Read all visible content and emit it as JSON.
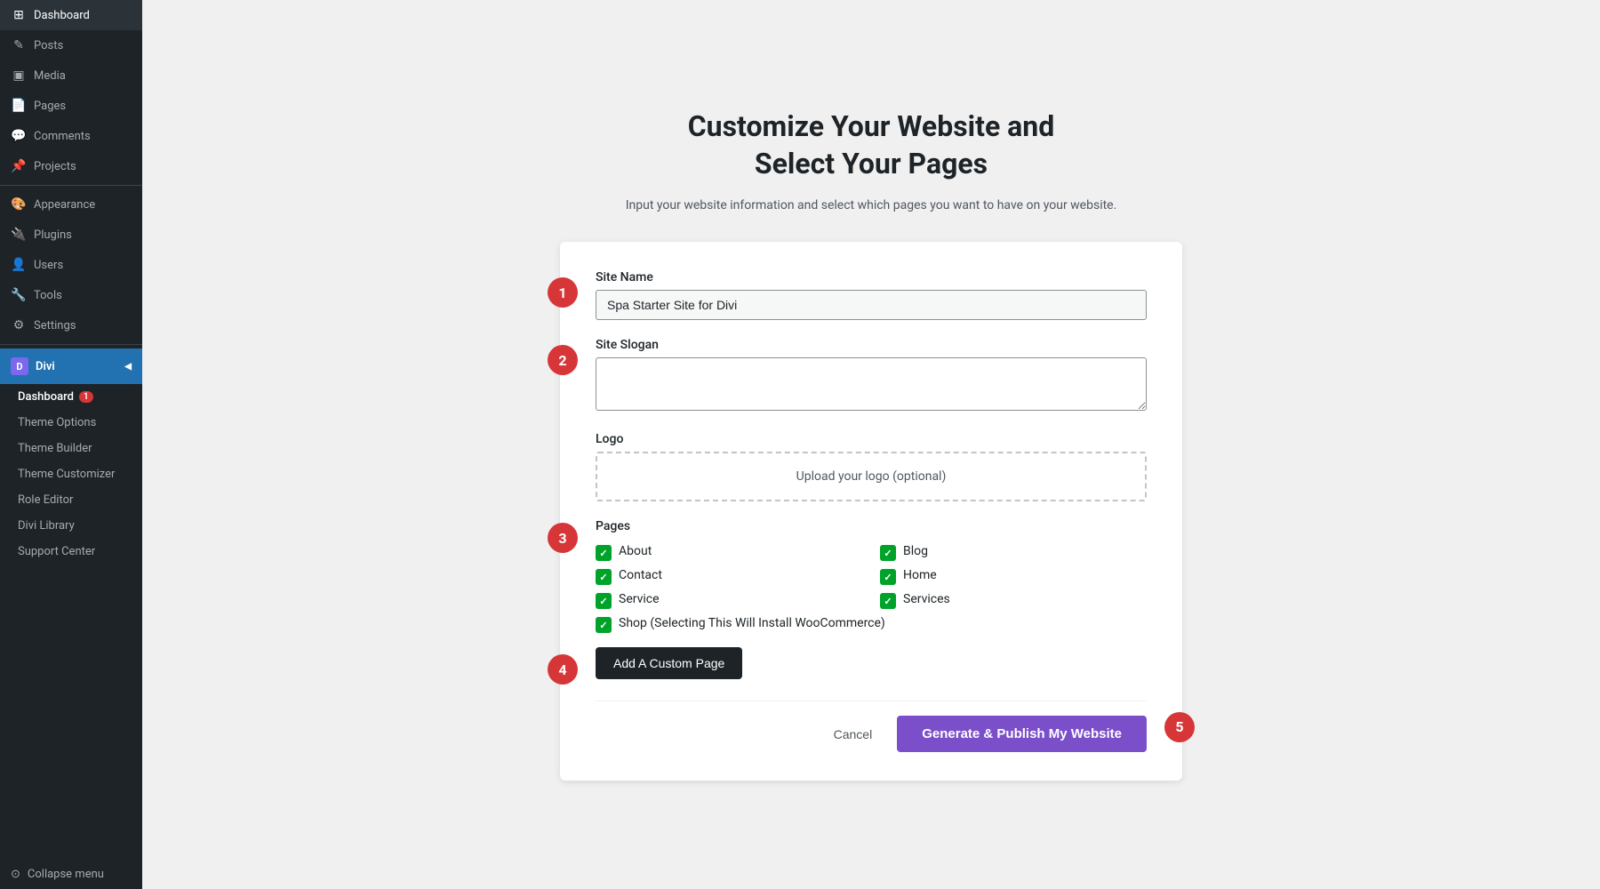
{
  "sidebar": {
    "items": [
      {
        "id": "dashboard",
        "label": "Dashboard",
        "icon": "⊞"
      },
      {
        "id": "posts",
        "label": "Posts",
        "icon": "✏"
      },
      {
        "id": "media",
        "label": "Media",
        "icon": "⊡"
      },
      {
        "id": "pages",
        "label": "Pages",
        "icon": "📄"
      },
      {
        "id": "comments",
        "label": "Comments",
        "icon": "💬"
      },
      {
        "id": "projects",
        "label": "Projects",
        "icon": "📌"
      },
      {
        "id": "appearance",
        "label": "Appearance",
        "icon": "🎨"
      },
      {
        "id": "plugins",
        "label": "Plugins",
        "icon": "🔌"
      },
      {
        "id": "users",
        "label": "Users",
        "icon": "👤"
      },
      {
        "id": "tools",
        "label": "Tools",
        "icon": "🔧"
      },
      {
        "id": "settings",
        "label": "Settings",
        "icon": "⚙"
      }
    ],
    "divi_label": "Divi",
    "divi_icon": "D",
    "submenu": [
      {
        "id": "dashboard-sub",
        "label": "Dashboard",
        "badge": "1"
      },
      {
        "id": "theme-options",
        "label": "Theme Options"
      },
      {
        "id": "theme-builder",
        "label": "Theme Builder"
      },
      {
        "id": "theme-customizer",
        "label": "Theme Customizer"
      },
      {
        "id": "role-editor",
        "label": "Role Editor"
      },
      {
        "id": "divi-library",
        "label": "Divi Library"
      },
      {
        "id": "support-center",
        "label": "Support Center"
      }
    ],
    "collapse_label": "Collapse menu"
  },
  "main": {
    "title_line1": "Customize Your Website and",
    "title_line2": "Select Your Pages",
    "subtitle": "Input your website information and select which pages you want to have on your website.",
    "form": {
      "site_name_label": "Site Name",
      "site_name_value": "Spa Starter Site for Divi",
      "site_slogan_label": "Site Slogan",
      "site_slogan_placeholder": "",
      "logo_label": "Logo",
      "logo_upload_text": "Upload your logo (optional)",
      "pages_label": "Pages",
      "pages": [
        {
          "id": "about",
          "label": "About",
          "checked": true
        },
        {
          "id": "blog",
          "label": "Blog",
          "checked": true
        },
        {
          "id": "contact",
          "label": "Contact",
          "checked": true
        },
        {
          "id": "home",
          "label": "Home",
          "checked": true
        },
        {
          "id": "service",
          "label": "Service",
          "checked": true
        },
        {
          "id": "services",
          "label": "Services",
          "checked": true
        },
        {
          "id": "shop",
          "label": "Shop (Selecting This Will Install WooCommerce)",
          "checked": true,
          "full_width": true
        }
      ],
      "add_custom_page_label": "Add A Custom Page",
      "cancel_label": "Cancel",
      "publish_label": "Generate & Publish My Website"
    },
    "steps": {
      "step1": "1",
      "step2": "2",
      "step3": "3",
      "step4": "4",
      "step5": "5"
    }
  }
}
